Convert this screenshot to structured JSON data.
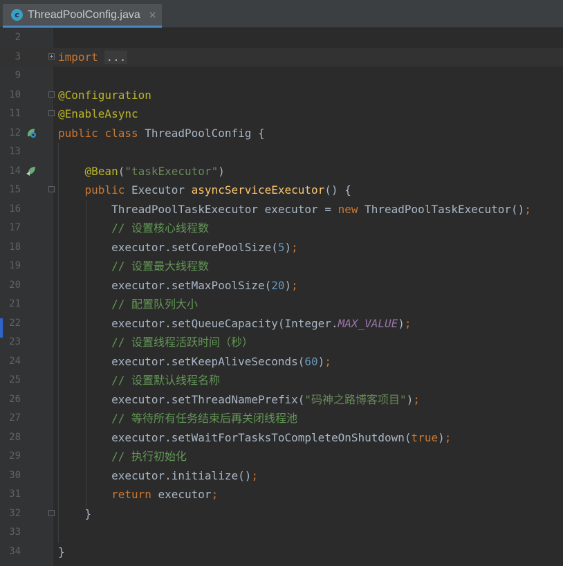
{
  "tab": {
    "icon_letter": "c",
    "title": "ThreadPoolConfig.java",
    "close": "×"
  },
  "lines": {
    "l2": "2",
    "l3": "3",
    "l9": "9",
    "l10": "10",
    "l11": "11",
    "l12": "12",
    "l13": "13",
    "l14": "14",
    "l15": "15",
    "l16": "16",
    "l17": "17",
    "l18": "18",
    "l19": "19",
    "l20": "20",
    "l21": "21",
    "l22": "22",
    "l23": "23",
    "l24": "24",
    "l25": "25",
    "l26": "26",
    "l27": "27",
    "l28": "28",
    "l29": "29",
    "l30": "30",
    "l31": "31",
    "l32": "32",
    "l33": "33",
    "l34": "34"
  },
  "code": {
    "import_kw": "import",
    "import_fold": "...",
    "configuration": "@Configuration",
    "enable_async": "@EnableAsync",
    "public": "public",
    "class": "class",
    "class_name": " ThreadPoolConfig {",
    "bean": "@Bean",
    "bean_paren_open": "(",
    "bean_arg": "\"taskExecutor\"",
    "bean_paren_close": ")",
    "executor_type": " Executor ",
    "method_name": "asyncServiceExecutor",
    "method_tail": "() {",
    "l16_a": "ThreadPoolTaskExecutor executor = ",
    "new": "new",
    "l16_b": " ThreadPoolTaskExecutor()",
    "semi": ";",
    "c17": "// 设置核心线程数",
    "l18_a": "executor.setCorePoolSize(",
    "l18_n": "5",
    "l18_b": ")",
    "c19": "// 设置最大线程数",
    "l20_a": "executor.setMaxPoolSize(",
    "l20_n": "20",
    "l20_b": ")",
    "c21": "// 配置队列大小",
    "l22_a": "executor.setQueueCapacity(Integer.",
    "l22_c": "MAX_VALUE",
    "l22_b": ")",
    "c23": "// 设置线程活跃时间（秒）",
    "l24_a": "executor.setKeepAliveSeconds(",
    "l24_n": "60",
    "l24_b": ")",
    "c25": "// 设置默认线程名称",
    "l26_a": "executor.setThreadNamePrefix(",
    "l26_s": "\"码神之路博客项目\"",
    "l26_b": ")",
    "c27": "// 等待所有任务结束后再关闭线程池",
    "l28_a": "executor.setWaitForTasksToCompleteOnShutdown(",
    "l28_t": "true",
    "l28_b": ")",
    "c29": "// 执行初始化",
    "l30_a": "executor.initialize()",
    "return": "return",
    "l31_b": " executor",
    "close_brace": "}"
  },
  "colors": {
    "background": "#2b2b2b",
    "keyword": "#cc7832",
    "annotation": "#bbb529",
    "string": "#6a8759",
    "number": "#6897bb",
    "method": "#ffc66d",
    "comment": "#629755",
    "constant": "#9876aa"
  },
  "icons": {
    "tab_icon": "java-class-icon",
    "gutter_12": "spring-bean-class-icon",
    "gutter_14": "spring-bean-method-icon"
  }
}
